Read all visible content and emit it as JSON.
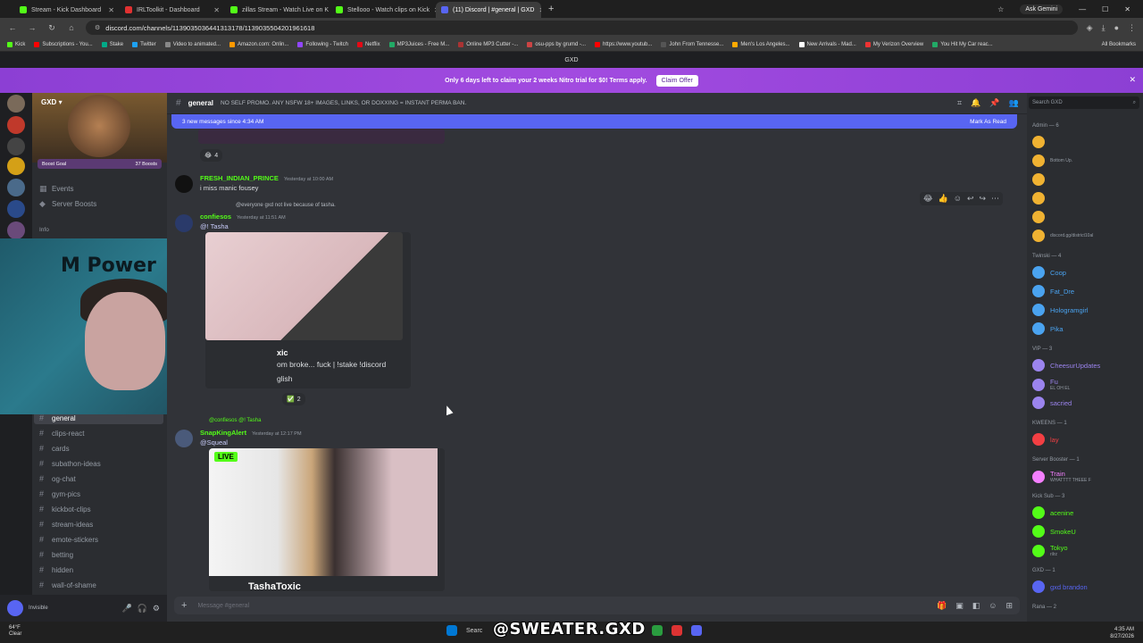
{
  "browser": {
    "tabs": [
      {
        "label": "Stream - Kick Dashboard",
        "color": "#53fc18"
      },
      {
        "label": "IRLToolkit - Dashboard",
        "color": "#e03131"
      },
      {
        "label": "zillas Stream - Watch Live on K",
        "color": "#53fc18"
      },
      {
        "label": "Stellooo - Watch clips on Kick",
        "color": "#53fc18"
      },
      {
        "label": "(11) Discord | #general | GXD",
        "color": "#5865f2"
      }
    ],
    "new_tab": "+",
    "ask_gemini": "Ask Gemini",
    "url": "discord.com/channels/1139035036441313178/1139035504201961618",
    "bookmarks": [
      "Kick",
      "Subscriptions - You...",
      "Stake",
      "Twitter",
      "Video to animated...",
      "Amazon.com: Onlin...",
      "Following - Twitch",
      "Netflix",
      "MP3Juices - Free M...",
      "Online MP3 Cutter -...",
      "osu-pps by grumd -...",
      "https://www.youtub...",
      "John From Tennesse...",
      "Men's Los Angeles...",
      "New Arrivals - Mad...",
      "My Verizon Overview",
      "You Hit My Car reac..."
    ],
    "all_bookmarks": "All Bookmarks"
  },
  "discord": {
    "window_title": "GXD",
    "nitro_banner": "Only 6 days left to claim your 2 weeks Nitro trial for $0! Terms apply.",
    "claim_offer": "Claim Offer",
    "server_name": "GXD",
    "boost_goal": "Boost Goal",
    "boost_count": "37 Boosts",
    "nav": {
      "events": "Events",
      "server_boosts": "Server Boosts"
    },
    "category_info": "Info",
    "channels": [
      "general",
      "clips-react",
      "cards",
      "subathon-ideas",
      "og-chat",
      "gym-pics",
      "kickbot-clips",
      "stream-ideas",
      "emote-stickers",
      "betting",
      "hidden",
      "wall-of-shame"
    ],
    "selected_channel": "general",
    "channel_topic": "NO SELF PROMO. ANY NSFW 18+ IMAGES, LINKS, OR DOXXING = INSTANT PERMA BAN.",
    "new_messages": "3 new messages since 4:34 AM",
    "mark_as_read": "Mark As Read",
    "messages": [
      {
        "author": "FRESH_INDIAN_PRINCE",
        "time": "Yesterday at 10:00 AM",
        "text": "i miss manic fousey",
        "color": "#53fc18"
      },
      {
        "reply": "@everyone gxd not live because of tasha.",
        "author": "confiesos",
        "time": "Yesterday at 11:51 AM",
        "text": "@! Tasha",
        "color": "#53fc18",
        "embed_title": "xic",
        "embed_desc": "om broke... fuck | !stake !discord",
        "embed_lang": "glish"
      },
      {
        "reply": "@confiesos @! Tasha",
        "author": "SnapKingAlert",
        "time": "Yesterday at 12:17 PM",
        "text": "@Squeal",
        "color": "#53fc18",
        "embed_title": "TashaToxic",
        "live": "LIVE"
      }
    ],
    "reactions": [
      {
        "emoji": "😂",
        "count": "4"
      },
      {
        "emoji": "✅",
        "count": "2"
      }
    ],
    "composer_placeholder": "Message #general",
    "user_status": "Invisible",
    "search_placeholder": "Search GXD",
    "member_groups": [
      {
        "title": "Admin — 6",
        "members": [
          {
            "name": "",
            "sub": "",
            "color": "#f0b232"
          },
          {
            "name": "",
            "sub": "Bottom Up.",
            "color": "#f0b232"
          },
          {
            "name": "",
            "sub": "",
            "color": "#f0b232"
          },
          {
            "name": "",
            "sub": "",
            "color": "#f0b232"
          },
          {
            "name": "",
            "sub": "",
            "color": "#f0b232"
          },
          {
            "name": "",
            "sub": "discord.gg/district10al",
            "color": "#f0b232"
          }
        ]
      },
      {
        "title": "Twinski — 4",
        "members": [
          {
            "name": "Coop",
            "sub": "",
            "color": "#4aa3f0"
          },
          {
            "name": "Fat_Dre",
            "sub": "",
            "color": "#4aa3f0"
          },
          {
            "name": "Hologramgirl",
            "sub": "",
            "color": "#4aa3f0"
          },
          {
            "name": "Pika",
            "sub": "",
            "color": "#4aa3f0"
          }
        ]
      },
      {
        "title": "VIP — 3",
        "members": [
          {
            "name": "CheesurUpdates",
            "sub": "",
            "color": "#9b84ee"
          },
          {
            "name": "Fu",
            "sub": "EL OH EL",
            "color": "#9b84ee"
          },
          {
            "name": "sacried",
            "sub": "",
            "color": "#9b84ee"
          }
        ]
      },
      {
        "title": "KWEENS — 1",
        "members": [
          {
            "name": "lay",
            "sub": "",
            "color": "#f23f43"
          }
        ]
      },
      {
        "title": "Server Booster — 1",
        "members": [
          {
            "name": "Train",
            "sub": "WHATTTT THEEE F",
            "color": "#f47fff"
          }
        ]
      },
      {
        "title": "Kick Sub — 3",
        "members": [
          {
            "name": "acenine",
            "sub": "",
            "color": "#53fc18"
          },
          {
            "name": "SmokeU",
            "sub": "",
            "color": "#53fc18"
          },
          {
            "name": "Tokyo",
            "sub": "rilrz",
            "color": "#53fc18"
          }
        ]
      },
      {
        "title": "GXD — 1",
        "members": [
          {
            "name": "gxd brandon",
            "sub": "",
            "color": "#5865f2"
          }
        ]
      },
      {
        "title": "Rana — 2",
        "members": []
      }
    ]
  },
  "taskbar": {
    "weather_temp": "64°F",
    "weather_desc": "Clear",
    "search": "Searc",
    "watermark": "@SWEATER.GXD",
    "time": "4:35 AM",
    "date": "8/27/2026"
  }
}
